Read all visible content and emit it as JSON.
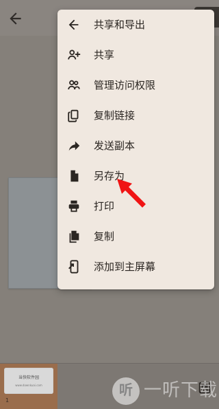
{
  "menu": {
    "header_label": "共享和导出",
    "items": [
      {
        "label": "共享",
        "icon": "person-add-icon"
      },
      {
        "label": "管理访问权限",
        "icon": "people-icon"
      },
      {
        "label": "复制链接",
        "icon": "copy-link-icon"
      },
      {
        "label": "发送副本",
        "icon": "share-forward-icon"
      },
      {
        "label": "另存为",
        "icon": "file-icon"
      },
      {
        "label": "打印",
        "icon": "printer-icon"
      },
      {
        "label": "复制",
        "icon": "copy-icon"
      },
      {
        "label": "添加到主屏幕",
        "icon": "add-to-home-screen-icon"
      }
    ]
  },
  "thumbnail": {
    "title": "当快软件园",
    "subtitle": "www.downkuai.com",
    "page_number": "1"
  },
  "watermark": {
    "logo_char": "听",
    "text": "一听下载"
  },
  "colors": {
    "menu_bg": "#f0e8e0",
    "overlay": "#8b8680",
    "pointer": "#f01414",
    "thumb_slot": "#9a6d4c"
  }
}
